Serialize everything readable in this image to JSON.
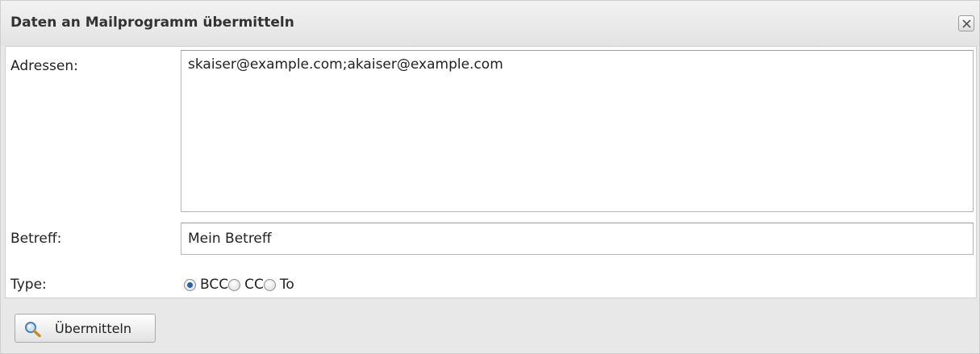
{
  "dialog": {
    "title": "Daten an Mailprogramm übermitteln"
  },
  "form": {
    "addresses_label": "Adressen:",
    "addresses_value": "skaiser@example.com;akaiser@example.com",
    "subject_label": "Betreff:",
    "subject_value": "Mein Betreff",
    "type_label": "Type:",
    "type_options": [
      {
        "label": "BCC",
        "selected": true
      },
      {
        "label": "CC",
        "selected": false
      },
      {
        "label": "To",
        "selected": false
      }
    ]
  },
  "footer": {
    "submit_label": "Übermitteln",
    "submit_icon": "magnifier-icon"
  },
  "colors": {
    "radio_selected": "#2a5ea8",
    "window_bg": "#e8e8e8"
  }
}
